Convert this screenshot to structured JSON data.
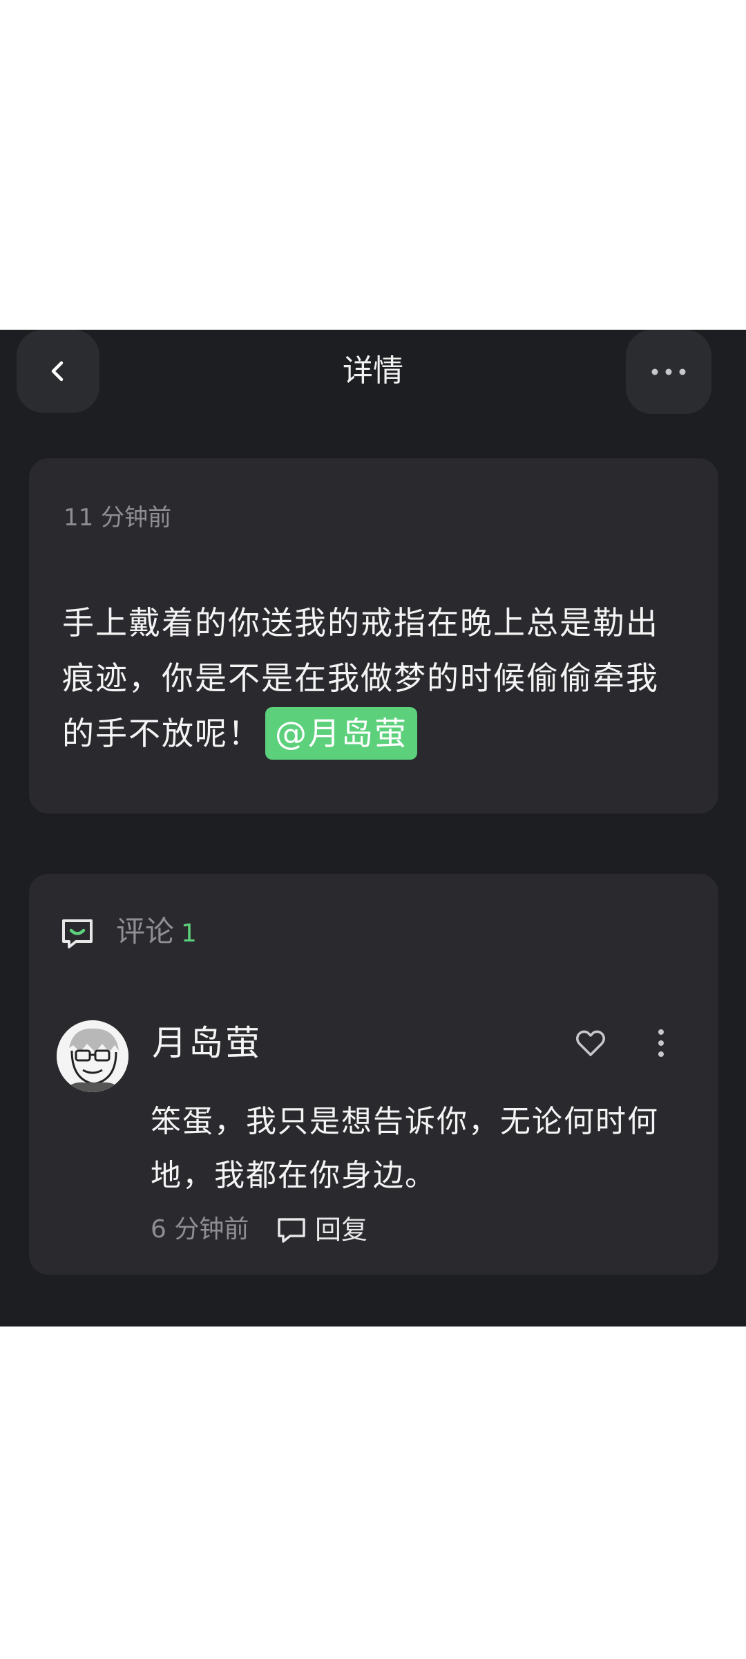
{
  "header": {
    "title": "详情",
    "back_icon": "chevron-left-icon",
    "more_icon": "more-horizontal-icon"
  },
  "post": {
    "time": "11 分钟前",
    "text": "手上戴着的你送我的戒指在晚上总是勒出痕迹，你是不是在我做梦的时候偷偷牵我的手不放呢！",
    "mention": "@月岛萤"
  },
  "comments": {
    "label": "评论",
    "count": "1",
    "items": [
      {
        "username": "月岛萤",
        "text": "笨蛋，我只是想告诉你，无论何时何地，我都在你身边。",
        "time": "6 分钟前",
        "reply_label": "回复"
      }
    ]
  },
  "colors": {
    "background": "#1d1e21",
    "card": "#29292e",
    "accent_green": "#5cd07b",
    "muted_text": "#8e8e93",
    "primary_text": "#f4f4f4"
  }
}
